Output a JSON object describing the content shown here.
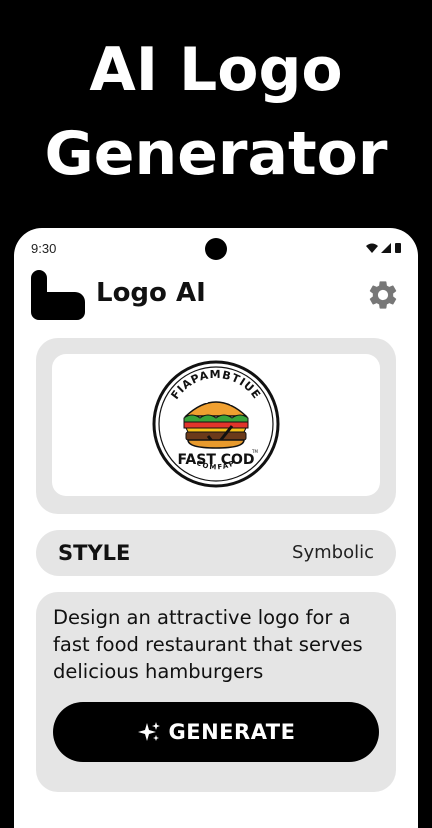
{
  "promo": {
    "line1": "AI Logo",
    "line2": "Generator"
  },
  "status_bar": {
    "time": "9:30",
    "icons": [
      "wifi-icon",
      "signal-icon",
      "battery-icon"
    ]
  },
  "app_bar": {
    "title": "Logo AI",
    "logo_icon": "app-logo-icon",
    "settings_icon": "gear-icon"
  },
  "preview": {
    "logo_top_text": "FIAPAMBTIUE",
    "logo_main_text": "FAST COD",
    "logo_bottom_text": "COMFAP",
    "logo_tm": "TM"
  },
  "style": {
    "label": "STYLE",
    "value": "Symbolic"
  },
  "prompt": {
    "text": "Design an attractive logo for a fast food restaurant that serves delicious hamburgers"
  },
  "generate_button": {
    "label": "GENERATE",
    "icon": "sparkle-icon"
  },
  "colors": {
    "background": "#000000",
    "card": "#e5e5e5",
    "surface": "#ffffff",
    "accent": "#000000"
  }
}
